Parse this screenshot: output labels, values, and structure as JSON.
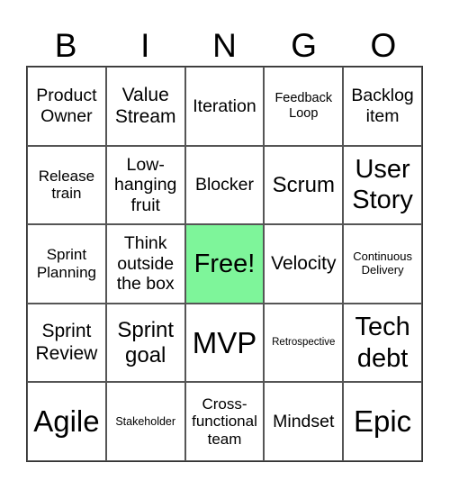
{
  "header": [
    "B",
    "I",
    "N",
    "G",
    "O"
  ],
  "colors": {
    "free_cell": "#7ef59a",
    "grid_line": "#555555"
  },
  "cells": [
    [
      "Product Owner",
      "Value Stream",
      "Iteration",
      "Feedback Loop",
      "Backlog item"
    ],
    [
      "Release train",
      "Low-hanging fruit",
      "Blocker",
      "Scrum",
      "User Story"
    ],
    [
      "Sprint Planning",
      "Think outside the box",
      "Free!",
      "Velocity",
      "Continuous Delivery"
    ],
    [
      "Sprint Review",
      "Sprint goal",
      "MVP",
      "Retrospective",
      "Tech debt"
    ],
    [
      "Agile",
      "Stakeholder",
      "Cross-functional team",
      "Mindset",
      "Epic"
    ]
  ]
}
